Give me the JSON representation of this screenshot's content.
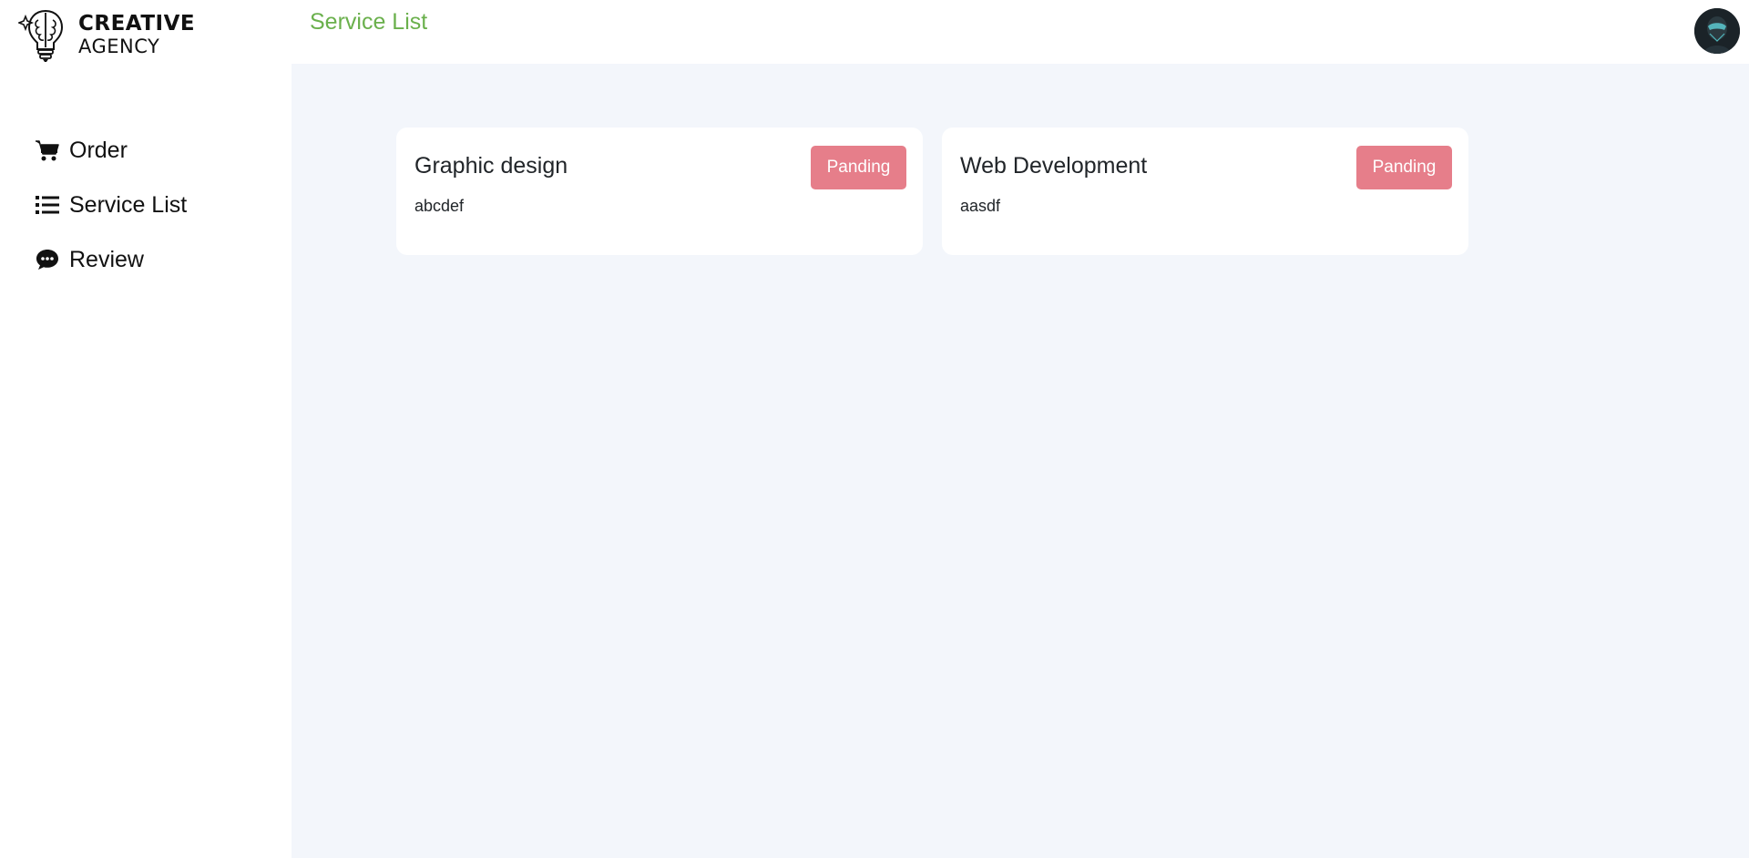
{
  "brand": {
    "line1": "CREATIVE",
    "line2": "AGENCY",
    "icon": "lightbulb-brain-icon"
  },
  "header": {
    "title": "Service List",
    "title_color": "#6ab04c",
    "avatar_icon": "user-avatar"
  },
  "sidebar": {
    "items": [
      {
        "label": "Order",
        "icon": "cart-icon"
      },
      {
        "label": "Service List",
        "icon": "list-icon"
      },
      {
        "label": "Review",
        "icon": "comment-icon"
      }
    ]
  },
  "services": [
    {
      "title": "Graphic design",
      "description": "abcdef",
      "status": "Panding"
    },
    {
      "title": "Web Development",
      "description": "aasdf",
      "status": "Panding"
    }
  ],
  "colors": {
    "main_bg": "#f3f6fb",
    "status_pending": "#e67e8a"
  }
}
